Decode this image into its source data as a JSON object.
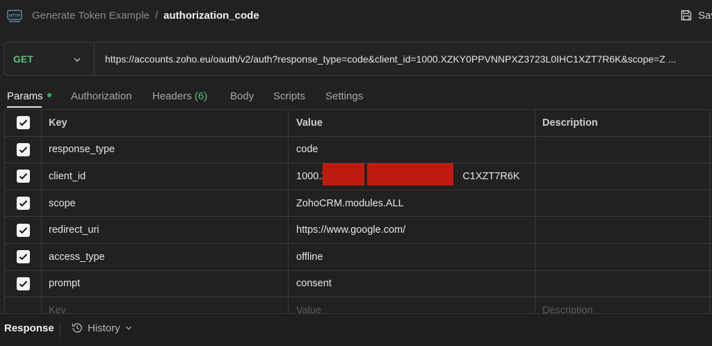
{
  "header": {
    "icon": "http-icon",
    "collection": "Generate Token Example",
    "separator": "/",
    "request_name": "authorization_code",
    "save_label": "Sav"
  },
  "request": {
    "method": "GET",
    "url": "https://accounts.zoho.eu/oauth/v2/auth?response_type=code&client_id=1000.XZKY0PPVNNPXZ3723L0IHC1XZT7R6K&scope=Z ..."
  },
  "tabs": {
    "params": "Params",
    "authorization": "Authorization",
    "headers": "Headers",
    "headers_count": "(6)",
    "body": "Body",
    "scripts": "Scripts",
    "settings": "Settings"
  },
  "table": {
    "columns": {
      "key": "Key",
      "value": "Value",
      "description": "Description"
    },
    "rows": [
      {
        "key": "response_type",
        "value": "code",
        "checked": true
      },
      {
        "key": "client_id",
        "value": "1000.X                                                C1XZT7R6K",
        "checked": true
      },
      {
        "key": "scope",
        "value": "ZohoCRM.modules.ALL",
        "checked": true
      },
      {
        "key": "redirect_uri",
        "value": "https://www.google.com/",
        "checked": true
      },
      {
        "key": "access_type",
        "value": "offline",
        "checked": true
      },
      {
        "key": "prompt",
        "value": "consent",
        "checked": true
      }
    ],
    "placeholder": {
      "key": "Key",
      "value": "Value",
      "description": "Description"
    }
  },
  "footer": {
    "response_label": "Response",
    "history_label": "History"
  },
  "colors": {
    "background": "#212121",
    "method_green": "#5fbf7f",
    "active_dot": "#2fb25a",
    "redaction": "#c01a0f"
  }
}
